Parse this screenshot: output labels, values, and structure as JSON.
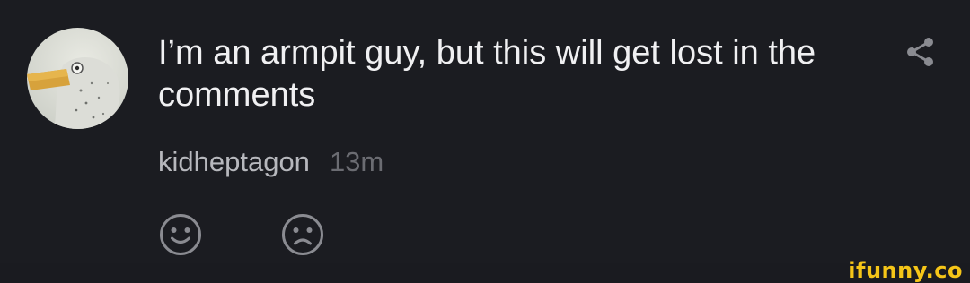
{
  "comment": {
    "text": "I’m an armpit guy, but this will get lost in the comments",
    "username": "kidheptagon",
    "time_ago": "13m"
  },
  "icons": {
    "share": "share-icon",
    "like": "smile-face-icon",
    "dislike": "frown-face-icon"
  },
  "watermark": {
    "brand": "ifunny.co"
  },
  "colors": {
    "background": "#1b1c21",
    "text_primary": "#f0f0f2",
    "text_secondary": "#b7b8bd",
    "text_muted": "#6b6c72",
    "icon": "#8a8b91",
    "brand": "#f5c518"
  }
}
